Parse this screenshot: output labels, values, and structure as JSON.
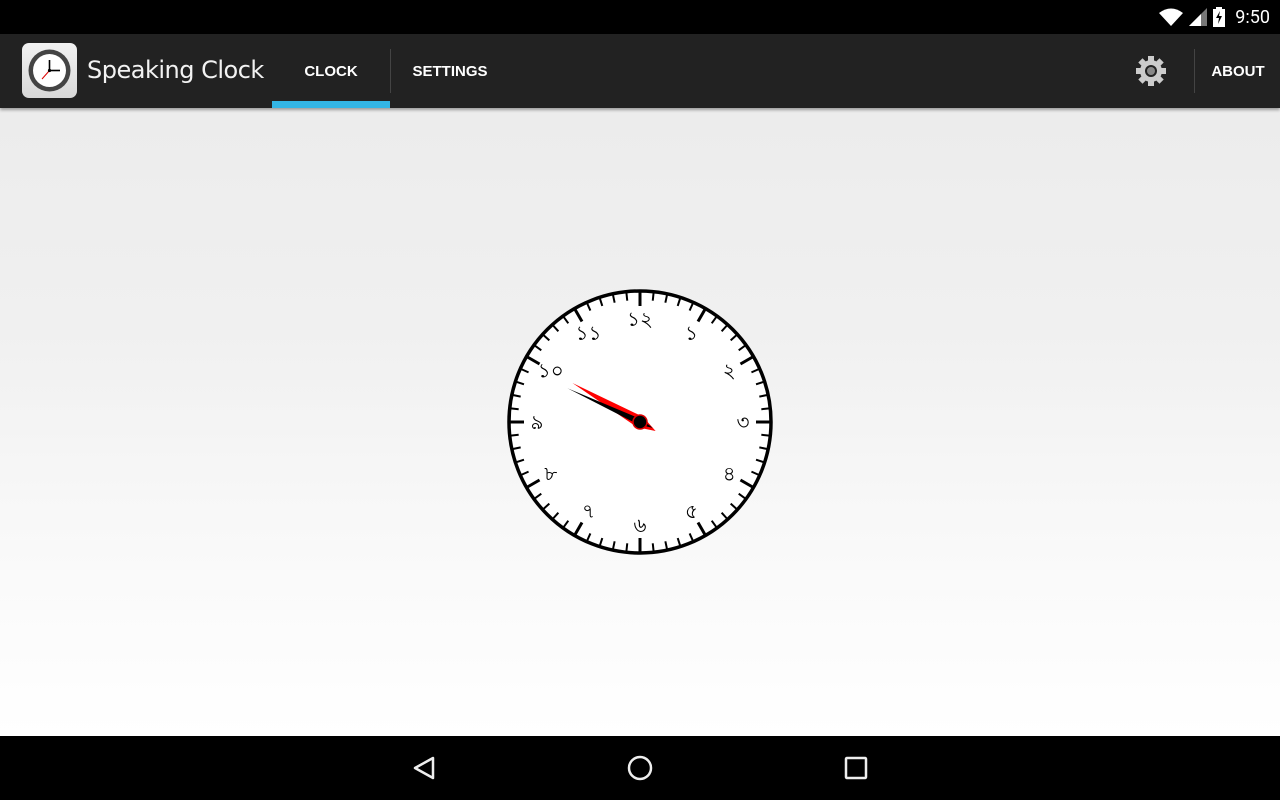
{
  "status_bar": {
    "time": "9:50",
    "icons": [
      "wifi-icon",
      "cell-signal-icon",
      "battery-charging-icon"
    ]
  },
  "action_bar": {
    "app_title": "Speaking Clock",
    "app_icon": "clock-icon",
    "tabs": [
      {
        "label": "CLOCK",
        "selected": true
      },
      {
        "label": "SETTINGS",
        "selected": false
      }
    ],
    "settings_icon": "gear-icon",
    "about_label": "ABOUT",
    "accent_color": "#33b5e5"
  },
  "clock": {
    "time_shown": "9:50",
    "hour": 9,
    "minute": 50,
    "numerals": [
      "১২",
      "১",
      "২",
      "৩",
      "৪",
      "৫",
      "৬",
      "৭",
      "৮",
      "৯",
      "১০",
      "১১"
    ],
    "hour_hand_color": "#000000",
    "minute_hand_color": "#ff0000"
  },
  "nav_bar": {
    "buttons": [
      "back-icon",
      "home-icon",
      "recents-icon"
    ]
  }
}
